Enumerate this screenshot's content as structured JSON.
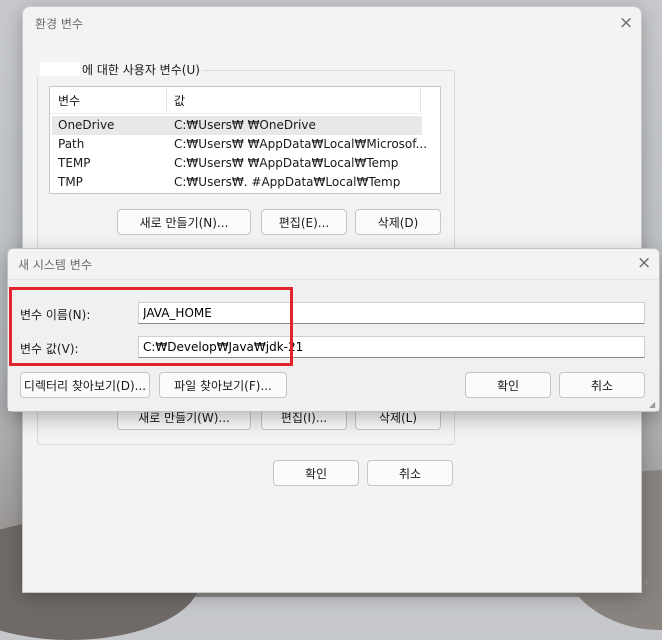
{
  "env_window": {
    "title": "환경 변수",
    "user_group_title": "에 대한 사용자 변수(U)",
    "columns": [
      "변수",
      "값"
    ],
    "rows": [
      {
        "name": "OneDrive",
        "value": "C:₩Users₩        ₩OneDrive"
      },
      {
        "name": "Path",
        "value": "C:₩Users₩         ₩AppData₩Local₩Microsof..."
      },
      {
        "name": "TEMP",
        "value": "C:₩Users₩         ₩AppData₩Local₩Temp"
      },
      {
        "name": "TMP",
        "value": "C:₩Users₩.         #AppData₩Local₩Temp"
      }
    ],
    "user_buttons": {
      "new": "새로 만들기(N)...",
      "edit": "편집(E)...",
      "delete": "삭제(D)"
    },
    "system_buttons": {
      "new": "새로 만들기(W)...",
      "edit": "편집(I)...",
      "delete": "삭제(L)"
    },
    "ok": "확인",
    "cancel": "취소"
  },
  "new_var_dialog": {
    "title": "새 시스템 변수",
    "name_label": "변수 이름(N):",
    "name_value": "JAVA_HOME",
    "value_label": "변수 값(V):",
    "value_value": "C:₩Develop₩Java₩jdk-21",
    "browse_dir": "디렉터리 찾아보기(D)...",
    "browse_file": "파일 찾아보기(F)...",
    "ok": "확인",
    "cancel": "취소"
  },
  "colors": {
    "highlight": "#e0262c",
    "window_bg": "#f3f3f3"
  }
}
